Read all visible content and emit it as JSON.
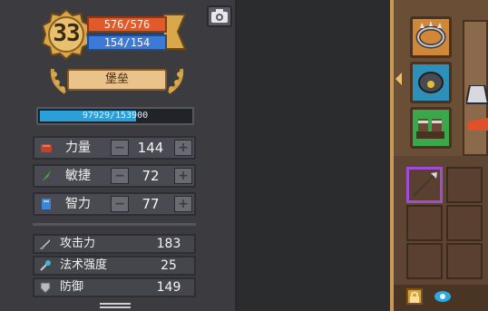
{
  "player": {
    "level": "33",
    "hp": "576/576",
    "mp": "154/154",
    "title": "堡垒",
    "xp": "97929/153900",
    "xp_fraction": 0.636
  },
  "attributes": [
    {
      "label": "力量",
      "value": "144",
      "icon": "fist-icon",
      "color": "#c8402a"
    },
    {
      "label": "敏捷",
      "value": "72",
      "icon": "feather-icon",
      "color": "#3cae3a"
    },
    {
      "label": "智力",
      "value": "77",
      "icon": "book-icon",
      "color": "#3a86d8"
    }
  ],
  "derived_stats": [
    {
      "label": "攻击力",
      "value": "183",
      "icon": "sword-icon"
    },
    {
      "label": "法术强度",
      "value": "25",
      "icon": "wand-icon"
    },
    {
      "label": "防御",
      "value": "149",
      "icon": "shield-icon"
    }
  ],
  "buttons": {
    "minus": "−",
    "plus": "+"
  },
  "colors": {
    "hp": "#e05a2c",
    "mp": "#3c7ad8",
    "xp": "#2c9ed8",
    "gold": "#d8a84a",
    "selected_slot": "#a24bd6"
  },
  "inventory": {
    "equipment": [
      "spiked-collar-icon",
      "amulet-icon",
      "boots-icon"
    ],
    "bag": [
      "spear-icon"
    ]
  }
}
